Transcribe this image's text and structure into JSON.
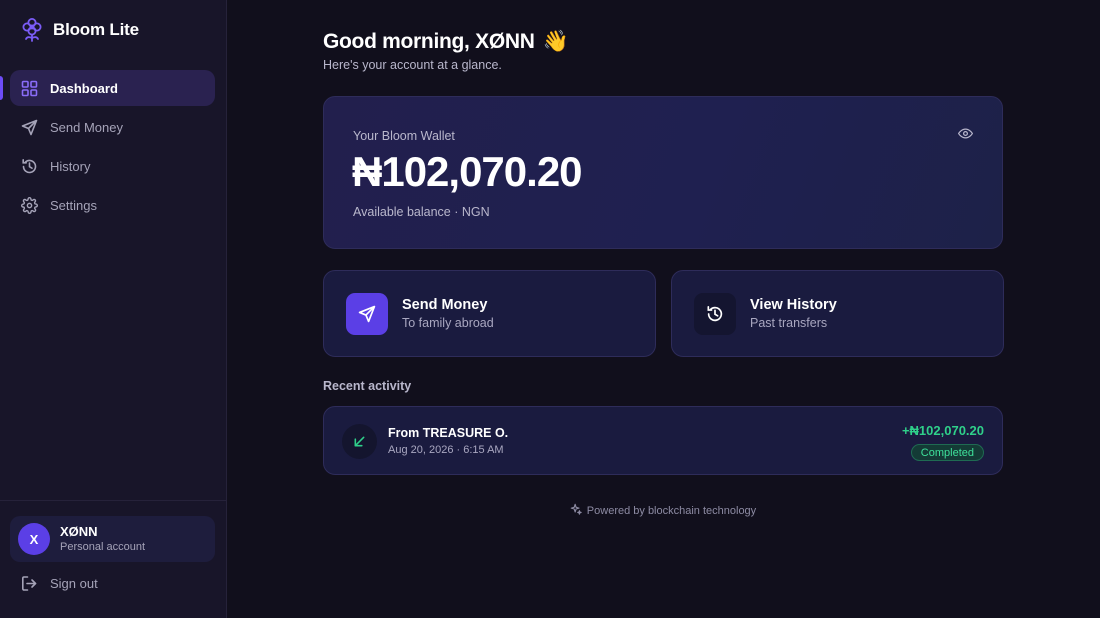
{
  "app": {
    "name": "Bloom Lite",
    "logo_icon": "flower-icon"
  },
  "colors": {
    "accent": "#5b3fe6",
    "success": "#2fd08a",
    "sidebar_bg": "#181529",
    "main_bg": "#110f1c"
  },
  "sidebar": {
    "items": [
      {
        "label": "Dashboard",
        "icon": "dashboard-icon",
        "active": true
      },
      {
        "label": "Send Money",
        "icon": "send-icon",
        "active": false
      },
      {
        "label": "History",
        "icon": "history-icon",
        "active": false
      },
      {
        "label": "Settings",
        "icon": "gear-icon",
        "active": false
      }
    ],
    "user": {
      "initial": "X",
      "name": "XØNN",
      "subtitle": "Personal account"
    },
    "signout_label": "Sign out"
  },
  "greeting": {
    "title": "Good morning, XØNN",
    "emoji": "👋",
    "subtitle": "Here's your account at a glance."
  },
  "wallet": {
    "label": "Your Bloom Wallet",
    "amount": "₦102,070.20",
    "subtitle": "Available balance · NGN"
  },
  "actions": [
    {
      "title": "Send Money",
      "subtitle": "To family abroad",
      "icon": "send-icon"
    },
    {
      "title": "View History",
      "subtitle": "Past transfers",
      "icon": "history-icon"
    }
  ],
  "recent": {
    "title": "Recent activity",
    "items": [
      {
        "title": "From TREASURE O.",
        "date": "Aug 20, 2026 · 6:15 AM",
        "amount": "+₦102,070.20",
        "status": "Completed",
        "icon": "arrow-down-left-icon"
      }
    ]
  },
  "footer": {
    "text": "Powered by blockchain technology",
    "icon": "sparkle-icon"
  }
}
